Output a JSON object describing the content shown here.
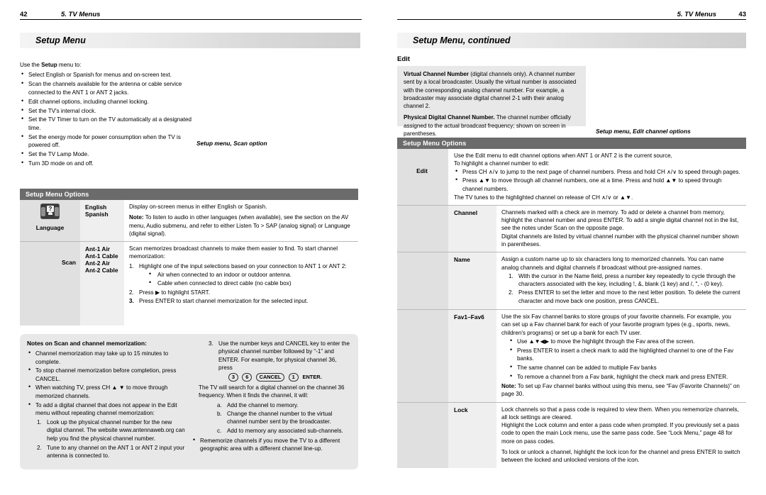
{
  "left_page": {
    "folio": "42",
    "chapter": "5.  TV Menus",
    "banner": "Setup Menu",
    "intro": "Use the Setup menu to:",
    "intro_lead": "Use the ",
    "intro_bold": "Setup",
    "intro_tail": " menu to:",
    "bullets": [
      "Select English or Spanish for menus and on-screen text.",
      "Scan the channels available for the antenna or cable service connected to the ANT 1 or ANT 2 jacks.",
      "Edit channel options, including channel locking.",
      "Set the TV's internal clock.",
      "Set the TV Timer to turn on the TV automatically at a designated time.",
      "Set the energy mode for power consumption when the TV is powered off.",
      "Set the TV Lamp Mode.",
      "Turn 3D mode on and off."
    ],
    "caption": "Setup menu, Scan option",
    "table": {
      "header": "Setup Menu Options",
      "rows": [
        {
          "icon_label": "Language",
          "icon_name": "language-icon",
          "icon_glyph": "?",
          "values": [
            "English",
            "Spanish"
          ],
          "desc_p1": "Display on-screen menus in either English or Spanish.",
          "desc_note_label": "Note:",
          "desc_note": " To listen to audio in other languages (when available), see the section on the AV menu, Audio submenu, and refer to either Listen To > SAP (analog signal) or Language (digital signal)."
        },
        {
          "icon_label": "Scan",
          "values": [
            "Ant-1 Air",
            "Ant-1 Cable",
            "Ant-2 Air",
            "Ant-2 Cable"
          ],
          "desc_p1": "Scan memorizes broadcast channels to make them easier to find.  To start channel memorization:",
          "steps": [
            "Highlight one of the input selections based on your connection to ANT 1 or ANT 2:",
            "Press ▶ to highlight START.",
            "Press ENTER to start channel memorization for the selected input."
          ],
          "substeps": [
            "Air when connected to an indoor or outdoor antenna.",
            "Cable when connected to direct cable (no cable box)"
          ]
        }
      ]
    },
    "notes_box": {
      "title": "Notes on Scan and channel memorization:",
      "bullets": [
        "Channel memorization may take up to 15 minutes to complete.",
        "To stop channel memorization before completion, press CANCEL.",
        "When watching TV, press CH ▲ ▼ to move through memorized channels.",
        "To add a digital channel that does not appear in the Edit menu without repeating channel memorization:"
      ],
      "steps": [
        "Look up the physical channel number for the new digital channel.  The website www.antennaweb.org can help you find the physical channel number.",
        "Tune to any channel on the ANT 1 or ANT 2 input your antenna is connected to.",
        "Use the number keys and CANCEL key to enter the physical channel number followed by “-1” and ENTER.  For example, for physical channel 36, press"
      ],
      "keys": [
        "3",
        "6",
        "CANCEL",
        "1"
      ],
      "keys_trailing": "ENTER.",
      "after_keys": "The TV will search for a digital channel on the channel 36 frequency.  When it finds the channel, it will:",
      "letters": [
        "Add the channel to memory.",
        "Change the channel number to the virtual channel number sent by the broadcaster.",
        "Add to memory any associated sub-channels."
      ],
      "last_bullet": "Rememorize channels if you move the TV to a different geographic area with a different channel line-up."
    }
  },
  "right_page": {
    "folio": "43",
    "chapter": "5.  TV Menus",
    "banner": "Setup Menu, continued",
    "section_title": "Edit",
    "definition_box": {
      "term1": "Virtual Channel Number",
      "def1": " (digital channels only).  A channel number sent by a local broadcaster.  Usually the virtual number is associated with the corresponding analog channel number.  For example, a broadcaster may associate digital channel 2-1 with their analog channel 2.",
      "term2": "Physical Digital Channel Number.",
      "def2": "  The channel number officially assigned to the actual broadcast frequency; shown on screen in parentheses."
    },
    "caption": "Setup menu, Edit channel options",
    "table": {
      "header": "Setup Menu Options",
      "group_label": "Edit",
      "intro_rows": {
        "line1": "Use the Edit menu to edit channel options when ANT 1 or ANT 2 is the current source,",
        "line2": "To highlight a channel number to edit:",
        "bullets": [
          "Press CH ∧/∨ to jump to the next page of channel numbers.  Press and hold CH ∧/∨ to speed through pages.",
          "Press ▲▼ to move through all channel numbers, one at a time.  Press and hold ▲▼ to speed through channel numbers."
        ],
        "closing": "The TV tunes to the highlighted channel on release of CH ∧/∨ or ▲▼."
      },
      "rows": [
        {
          "label": "Channel",
          "paras": [
            "Channels marked with a check are in memory.  To add or delete a channel from memory, highlight the channel number and press ENTER.  To add a single digital channel not in the list, see the notes under Scan on the opposite page.",
            "Digital channels are listed by virtual channel number with the physical channel number shown in parentheses."
          ]
        },
        {
          "label": "Name",
          "paras": [
            "Assign a custom name up to six characters long to memorized channels.  You can name analog channels and digital channels if broadcast without pre-assigned names."
          ],
          "steps": [
            "With the cursor in the Name field, press a number key repeatedly to cycle through the characters associated with the key, including !, &, blank (1 key) and /, \", - (0 key).",
            "Press ENTER to set the letter and move to the next letter position.  To delete the current character and move back one position, press CANCEL."
          ]
        },
        {
          "label": "Fav1–Fav6",
          "paras": [
            "Use the six Fav channel banks to store groups of your favorite channels.  For example, you can set up a Fav channel bank for each of your favorite program types (e.g., sports, news, children's programs) or set up a bank for each TV user."
          ],
          "bullets": [
            "Use ▲▼◀▶ to move the highlight through the Fav area of the screen.",
            "Press ENTER to insert a check mark to add the highlighted channel to one of the Fav banks.",
            "The same channel can be added to multiple Fav banks",
            "To remove a channel from a Fav bank, highlight the check mark and press ENTER."
          ],
          "note_label": "Note:",
          "note": "   To set up Fav channel banks without using this menu, see “Fav (Favorite Channels)” on page 30."
        },
        {
          "label": "Lock",
          "paras": [
            "Lock channels so that a pass code is required to view them.  When you rememorize channels, all lock settings are cleared.",
            "Highlight the Lock column and enter a pass code when prompted.  If you previously set a pass code to open the main Lock menu, use the same pass code.  See “Lock Menu,” page 48 for more on pass codes.",
            "To lock or unlock a channel, highlight the lock icon for the channel and press ENTER to switch between the locked and unlocked versions of the icon."
          ]
        }
      ]
    }
  }
}
